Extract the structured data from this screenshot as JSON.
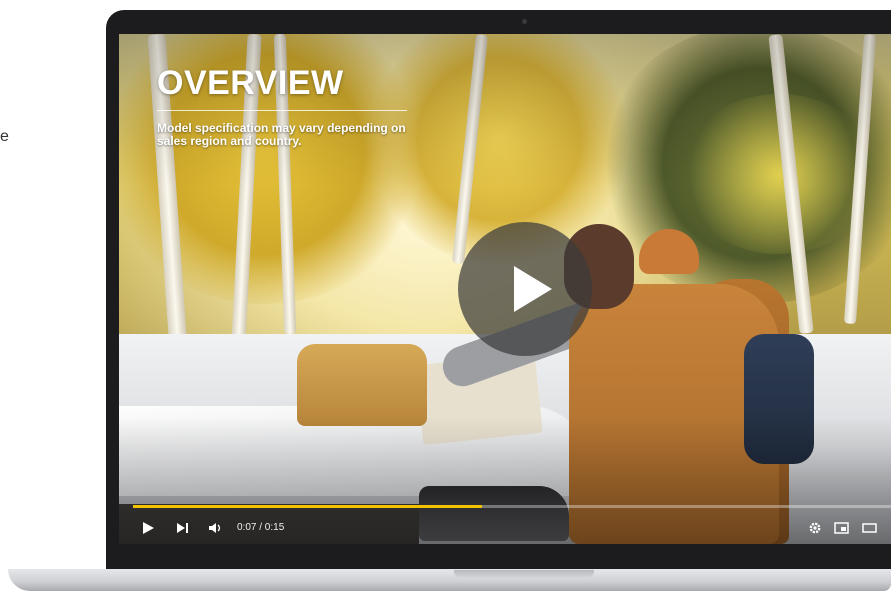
{
  "page": {
    "side_text": "e"
  },
  "video": {
    "title": "OVERVIEW",
    "subtitle": "Model specification may vary depending on sales region and country.",
    "current_time": "0:07",
    "duration": "0:15",
    "time_display": "0:07 / 0:15",
    "progress_fraction": 0.46,
    "accent_color": "#f2c100",
    "icons": {
      "play_overlay": "play-icon",
      "play": "play-icon",
      "next": "skip-next-icon",
      "volume": "volume-icon",
      "settings": "gear-icon",
      "miniplayer": "miniplayer-icon",
      "theater": "theater-mode-icon"
    }
  }
}
